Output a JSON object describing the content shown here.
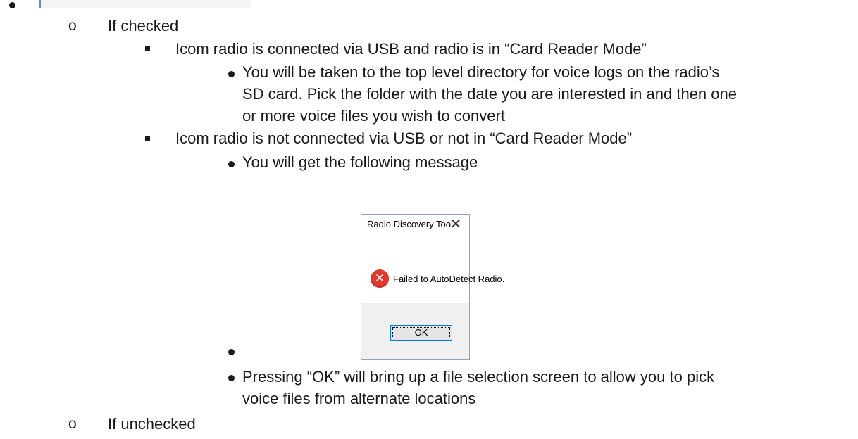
{
  "document": {
    "level1_if_checked": "If checked",
    "level2_connected": "Icom radio is connected via USB and radio is in “Card Reader Mode”",
    "level3_connected_lines": [
      "You will be taken to the top level directory for voice logs on the radio’s",
      "SD card. Pick the folder with the date you are interested in and then one",
      "or more voice files you wish to convert"
    ],
    "level2_not_connected": "Icom radio is not connected via USB or not in “Card Reader Mode”",
    "level3_message": "You will get the following message",
    "level3_pressing_lines": [
      "Pressing “OK” will bring up a file selection screen to allow you to pick",
      "voice files from alternate locations"
    ],
    "level1_if_unchecked": "If unchecked"
  },
  "dialog": {
    "title": "Radio Discovery Tool",
    "close_glyph": "✕",
    "icon_glyph": "✕",
    "message": "Failed to AutoDetect Radio.",
    "ok_label": "OK"
  },
  "colors": {
    "error_red": "#e2372a",
    "dialog_border": "#8aa4c8",
    "ok_border": "#0078d7"
  }
}
